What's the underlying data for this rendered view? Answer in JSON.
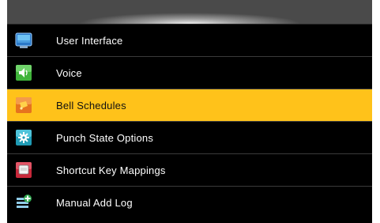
{
  "menu": {
    "items": [
      {
        "label": "User Interface",
        "icon": "monitor-icon",
        "selected": false
      },
      {
        "label": "Voice",
        "icon": "speaker-icon",
        "selected": false
      },
      {
        "label": "Bell Schedules",
        "icon": "bell-icon",
        "selected": true
      },
      {
        "label": "Punch State Options",
        "icon": "gear-icon",
        "selected": false
      },
      {
        "label": "Shortcut Key Mappings",
        "icon": "keyboard-key-icon",
        "selected": false
      },
      {
        "label": "Manual Add Log",
        "icon": "add-log-icon",
        "selected": false
      }
    ]
  },
  "colors": {
    "selected_background": "#ffc21a",
    "background": "#000000"
  }
}
